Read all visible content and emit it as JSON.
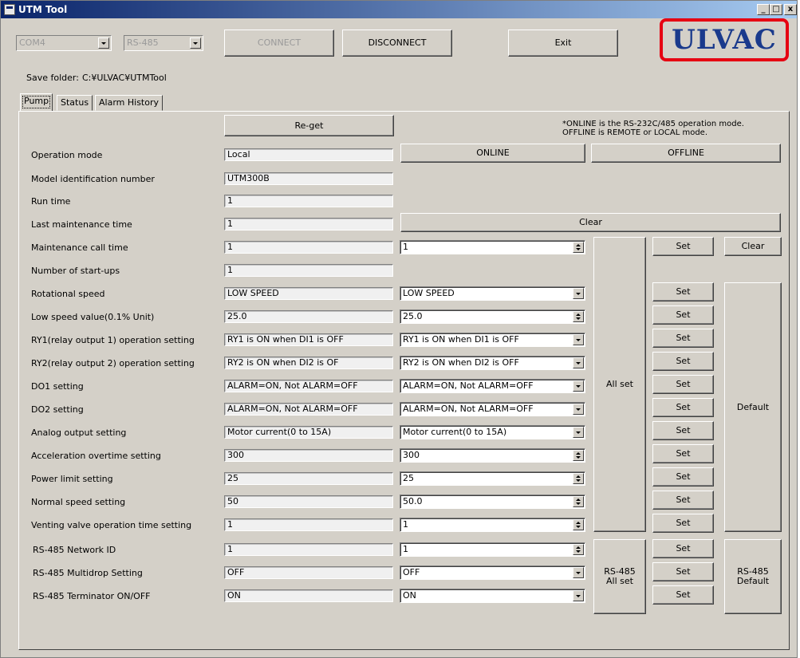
{
  "app": {
    "title": "UTM Tool",
    "minimize": "_",
    "maximize": "□",
    "close": "x"
  },
  "toolbar": {
    "port": "COM4",
    "mode": "RS-485",
    "connect": "CONNECT",
    "disconnect": "DISCONNECT",
    "exit": "Exit"
  },
  "logo": "ULVAC",
  "save_folder": {
    "label": "Save folder:",
    "path": "C:¥ULVAC¥UTMTool"
  },
  "tabs": [
    "Pump",
    "Status",
    "Alarm History"
  ],
  "pump": {
    "reget": "Re-get",
    "note1": "*ONLINE is the RS-232C/485 operation mode.",
    "note2": "OFFLINE is REMOTE or LOCAL mode.",
    "online": "ONLINE",
    "offline": "OFFLINE",
    "clear_main": "Clear",
    "all_set": "All set",
    "default": "Default",
    "rs485_all_set_1": "RS-485",
    "rs485_all_set_2": "All set",
    "rs485_default_1": "RS-485",
    "rs485_default_2": "Default",
    "set": "Set",
    "clear": "Clear",
    "rows": [
      {
        "label": "Operation mode",
        "value": "Local"
      },
      {
        "label": "Model identification number",
        "value": "UTM300B"
      },
      {
        "label": "Run time",
        "value": "1"
      },
      {
        "label": "Last maintenance time",
        "value": "1"
      },
      {
        "label": "Maintenance call time",
        "value": "1",
        "input": "1"
      },
      {
        "label": "Number of start-ups",
        "value": "1"
      },
      {
        "label": "Rotational speed",
        "value": "LOW SPEED",
        "input": "LOW SPEED"
      },
      {
        "label": "Low speed value(0.1% Unit)",
        "value": "25.0",
        "input": "25.0"
      },
      {
        "label": "RY1(relay output 1) operation setting",
        "value": "RY1 is ON when DI1 is OFF",
        "input": "RY1 is ON when DI1 is OFF"
      },
      {
        "label": "RY2(relay output 2) operation setting",
        "value": "RY2 is ON when DI2 is OF",
        "input": "RY2 is ON when DI2 is OFF"
      },
      {
        "label": "DO1 setting",
        "value": "ALARM=ON, Not ALARM=OFF",
        "input": "ALARM=ON, Not ALARM=OFF"
      },
      {
        "label": "DO2 setting",
        "value": "ALARM=ON, Not ALARM=OFF",
        "input": "ALARM=ON, Not ALARM=OFF"
      },
      {
        "label": "Analog output setting",
        "value": "Motor current(0 to 15A)",
        "input": "Motor current(0 to 15A)"
      },
      {
        "label": "Acceleration overtime setting",
        "value": "300",
        "input": "300"
      },
      {
        "label": "Power limit setting",
        "value": "25",
        "input": "25"
      },
      {
        "label": "Normal speed setting",
        "value": "50",
        "input": "50.0"
      },
      {
        "label": "Venting valve operation time setting",
        "value": "1",
        "input": "1"
      },
      {
        "label": "RS-485 Network ID",
        "value": "1",
        "input": "1"
      },
      {
        "label": "RS-485 Multidrop Setting",
        "value": "OFF",
        "input": "OFF"
      },
      {
        "label": "RS-485 Terminator ON/OFF",
        "value": "ON",
        "input": "ON"
      }
    ]
  },
  "colors": {
    "title_bar": "#0a246a",
    "logo_border": "#e60012",
    "logo_text": "#1a3a8c"
  }
}
